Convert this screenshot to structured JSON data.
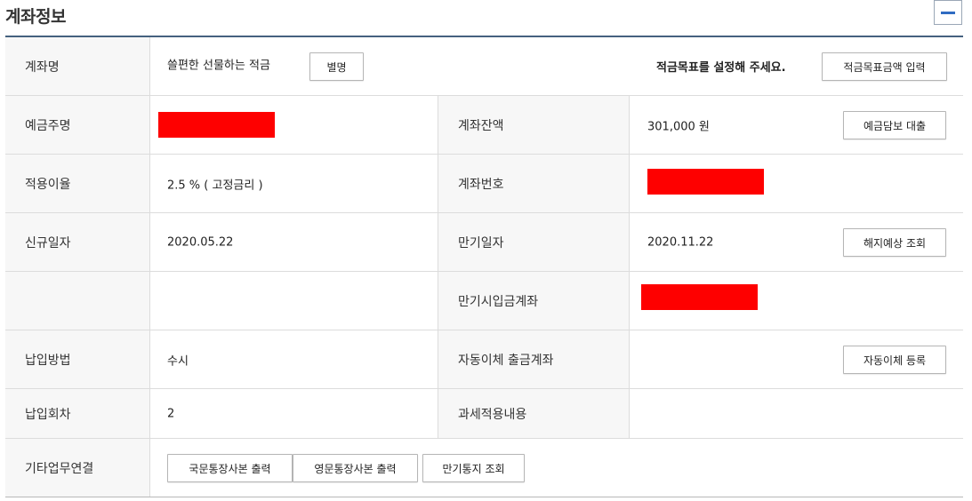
{
  "section": {
    "title": "계좌정보",
    "collapse_icon": "minus-icon",
    "accent": "#2f6bc2",
    "redaction_color": "#fe0000"
  },
  "rows": {
    "account_name": {
      "label": "계좌명",
      "value": "쓸편한 선물하는 적금",
      "alias_button": "별명",
      "goal_message": "적금목표를 설정해 주세요.",
      "goal_button": "적금목표금액 입력"
    },
    "holder": {
      "label": "예금주명",
      "balance_label": "계좌잔액",
      "balance_value": "301,000 원",
      "loan_button": "예금담보 대출"
    },
    "rate": {
      "label": "적용이율",
      "value": "2.5 % ( 고정금리 )",
      "account_no_label": "계좌번호"
    },
    "opened": {
      "label": "신규일자",
      "value": "2020.05.22",
      "maturity_label": "만기일자",
      "maturity_value": "2020.11.22",
      "cancel_button": "해지예상 조회"
    },
    "maturity_account": {
      "label": "만기시입금계좌"
    },
    "payment": {
      "label": "납입방법",
      "value": "수시",
      "auto_transfer_label": "자동이체 출금계좌",
      "auto_transfer_button": "자동이체 등록"
    },
    "installments": {
      "label": "납입회차",
      "value": "2",
      "tax_label": "과세적용내용"
    },
    "other": {
      "label": "기타업무연결",
      "buttons": [
        "국문통장사본 출력",
        "영문통장사본 출력",
        "만기통지 조회"
      ]
    }
  }
}
